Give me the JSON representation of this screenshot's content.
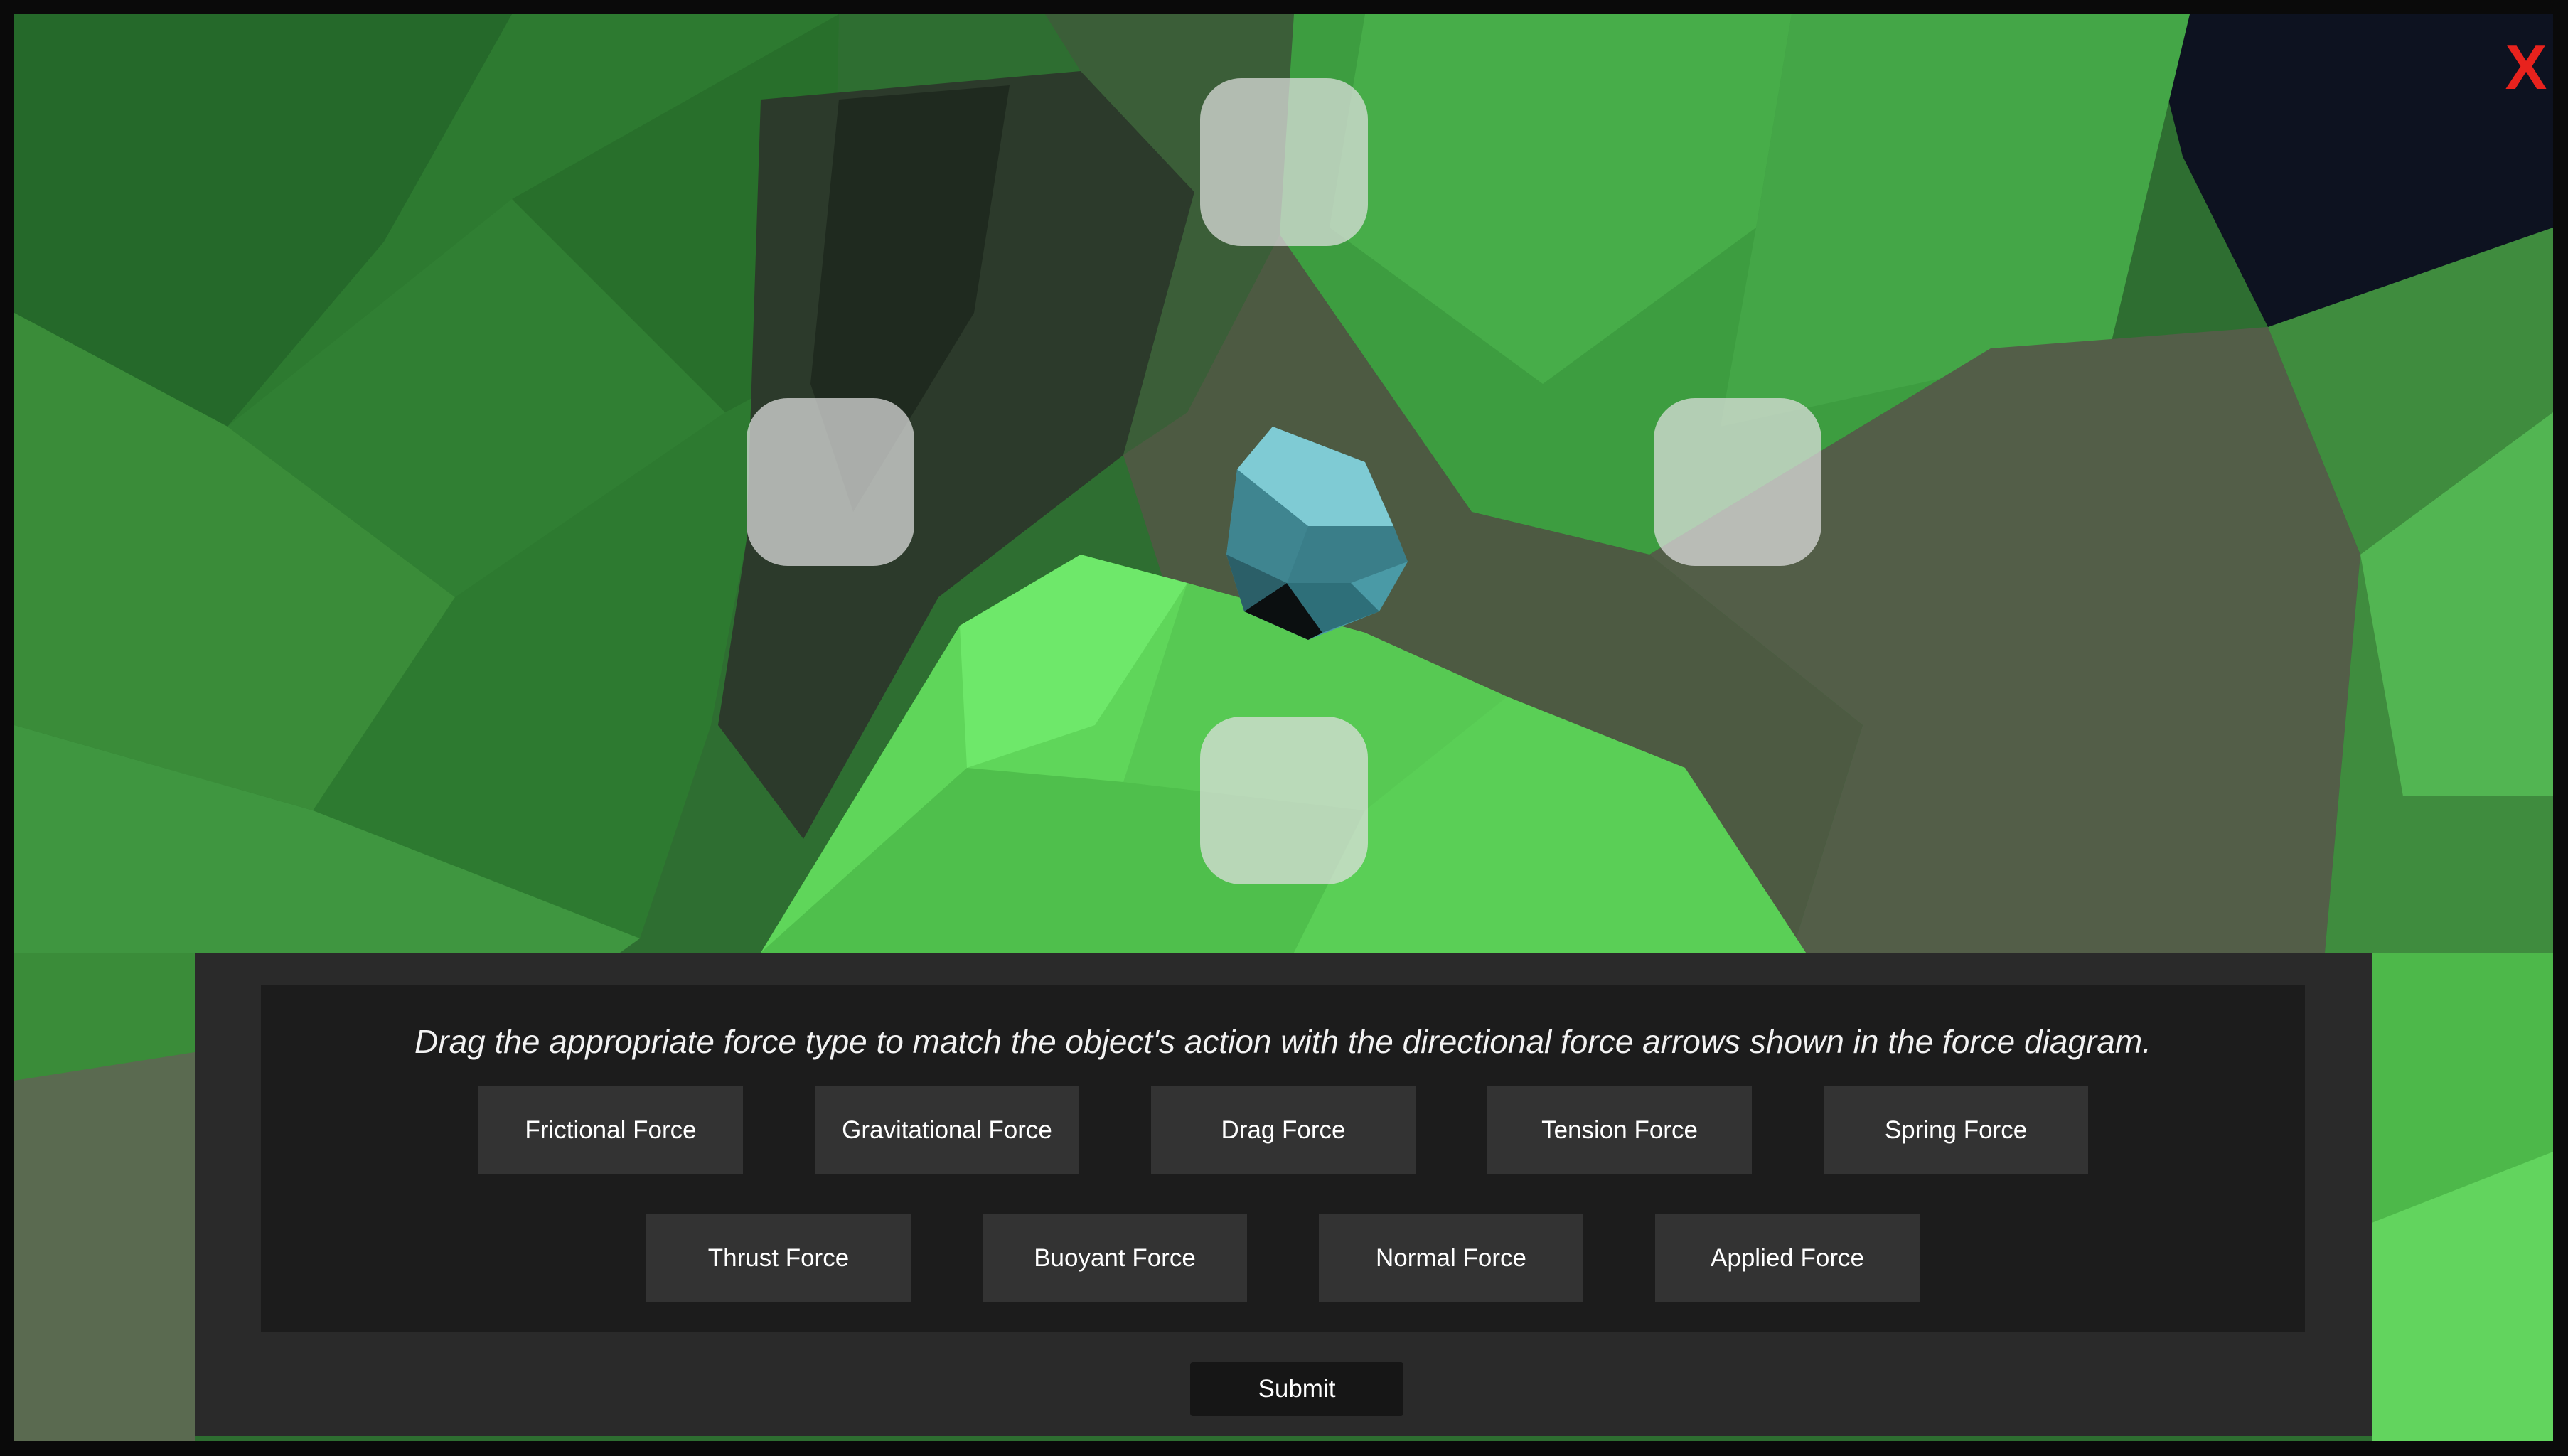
{
  "game": {
    "close_label": "X",
    "instruction": "Drag the appropriate force type to match the object's action with the directional force arrows shown in the force diagram.",
    "force_options_row1": [
      "Frictional Force",
      "Gravitational Force",
      "Drag Force",
      "Tension Force",
      "Spring Force"
    ],
    "force_options_row2": [
      "Thrust Force",
      "Buoyant Force",
      "Normal Force",
      "Applied Force"
    ],
    "submit_label": "Submit",
    "drop_slots": [
      "top",
      "left",
      "right",
      "bottom"
    ]
  },
  "colors": {
    "close_icon": "#e8221d",
    "panel": "#2a2a2a",
    "panel_inner": "#1c1c1c",
    "option_button": "#333333",
    "rock": "#5fb7c4",
    "grass": "#5fd65a"
  }
}
